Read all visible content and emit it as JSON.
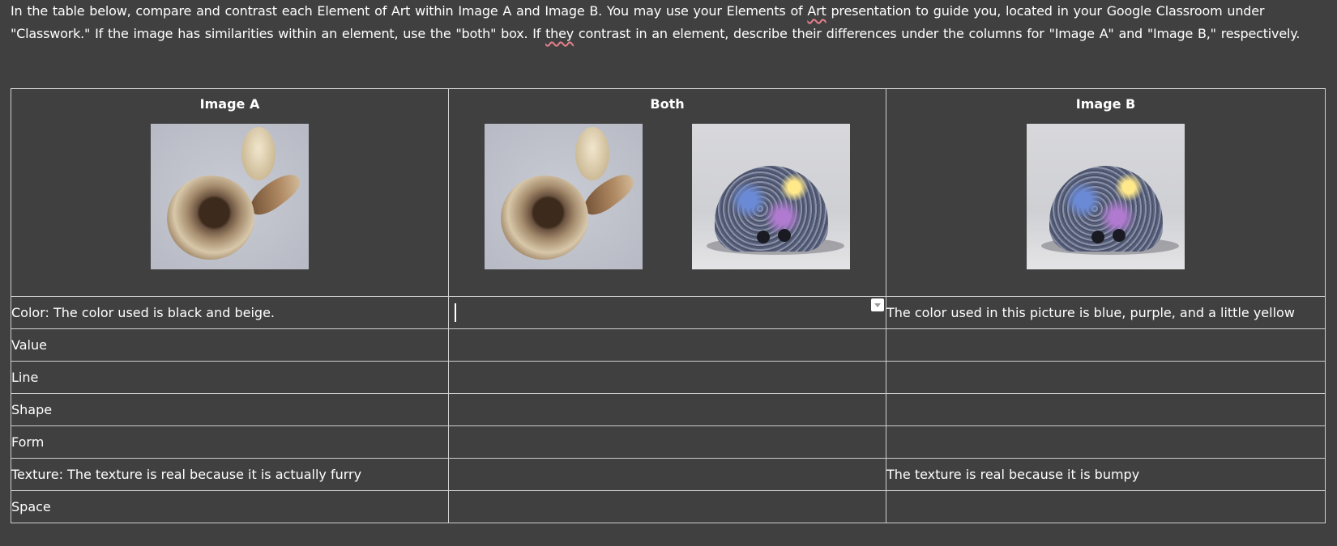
{
  "instructions": {
    "part1": "In the table below, compare and contrast each Element of Art within Image A and Image B. You may use your Elements of ",
    "art_word": "Art",
    "part2": " presentation to guide you, located in your Google Classroom under \"Classwork.\" If the image has similarities within an element, use the \"both\" box. If ",
    "they_word": "they",
    "part3": " contrast in an element, describe their differences under the columns for \"Image A\" and \"Image B,\" respectively."
  },
  "table": {
    "headers": {
      "image_a": "Image A",
      "both": "Both",
      "image_b": "Image B"
    },
    "images": {
      "image_a": "fur-ball-photo",
      "image_b": "glitter-ghost-sculpture-photo"
    },
    "rows": [
      {
        "image_a": "Color: The color used is black and beige.",
        "both": "",
        "image_b": "The color used in this picture is blue, purple, and a little yellow"
      },
      {
        "image_a": "Value",
        "both": "",
        "image_b": ""
      },
      {
        "image_a": "Line",
        "both": "",
        "image_b": ""
      },
      {
        "image_a": "Shape",
        "both": "",
        "image_b": ""
      },
      {
        "image_a": "Form",
        "both": "",
        "image_b": ""
      },
      {
        "image_a": "Texture: The texture is real because it is actually furry",
        "both": "",
        "image_b": "The texture is real because it is bumpy"
      },
      {
        "image_a": "Space",
        "both": "",
        "image_b": ""
      }
    ]
  },
  "colors": {
    "background": "#404040",
    "text": "#ffffff",
    "table_border": "#cfcfcf",
    "spellcheck_underline": "#e57f8a"
  }
}
